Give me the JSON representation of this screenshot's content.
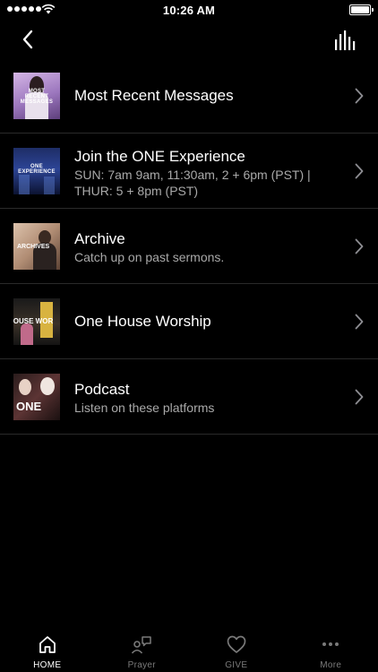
{
  "status_bar": {
    "time": "10:26 AM"
  },
  "nav": {
    "back_icon": "chevron-left-icon",
    "right_icon": "bars-icon"
  },
  "list": [
    {
      "title": "Most Recent Messages",
      "subtitle": "",
      "thumb_caption": "MOST RECENT MESSAGES",
      "thumb_colors": [
        "#c4a2d8",
        "#7d5c9b"
      ]
    },
    {
      "title": "Join the ONE Experience",
      "subtitle": "SUN: 7am 9am, 11:30am, 2 + 6pm (PST) | THUR: 5 + 8pm (PST)",
      "thumb_caption": "ONE EXPERIENCE",
      "thumb_colors": [
        "#2a3f88",
        "#0d1635"
      ]
    },
    {
      "title": "Archive",
      "subtitle": "Catch up on past sermons.",
      "thumb_caption": "ARCHIVES",
      "thumb_colors": [
        "#c9aa90",
        "#6e4f3f"
      ]
    },
    {
      "title": "One House Worship",
      "subtitle": "",
      "thumb_caption": "HOUSE WOR",
      "thumb_colors": [
        "#4a3e32",
        "#121212"
      ]
    },
    {
      "title": "Podcast",
      "subtitle": "Listen on these platforms",
      "thumb_caption": "ONE",
      "thumb_colors": [
        "#6a3a3a",
        "#1a1212"
      ]
    }
  ],
  "tabs": [
    {
      "label": "HOME",
      "icon": "home-icon",
      "active": true
    },
    {
      "label": "Prayer",
      "icon": "prayer-icon",
      "active": false
    },
    {
      "label": "GIVE",
      "icon": "heart-icon",
      "active": false
    },
    {
      "label": "More",
      "icon": "more-dots-icon",
      "active": false
    }
  ],
  "colors": {
    "background": "#000000",
    "divider": "#2a2a2a",
    "subtitle": "#a9a9a9",
    "inactive_tab": "#7a7a7a"
  }
}
